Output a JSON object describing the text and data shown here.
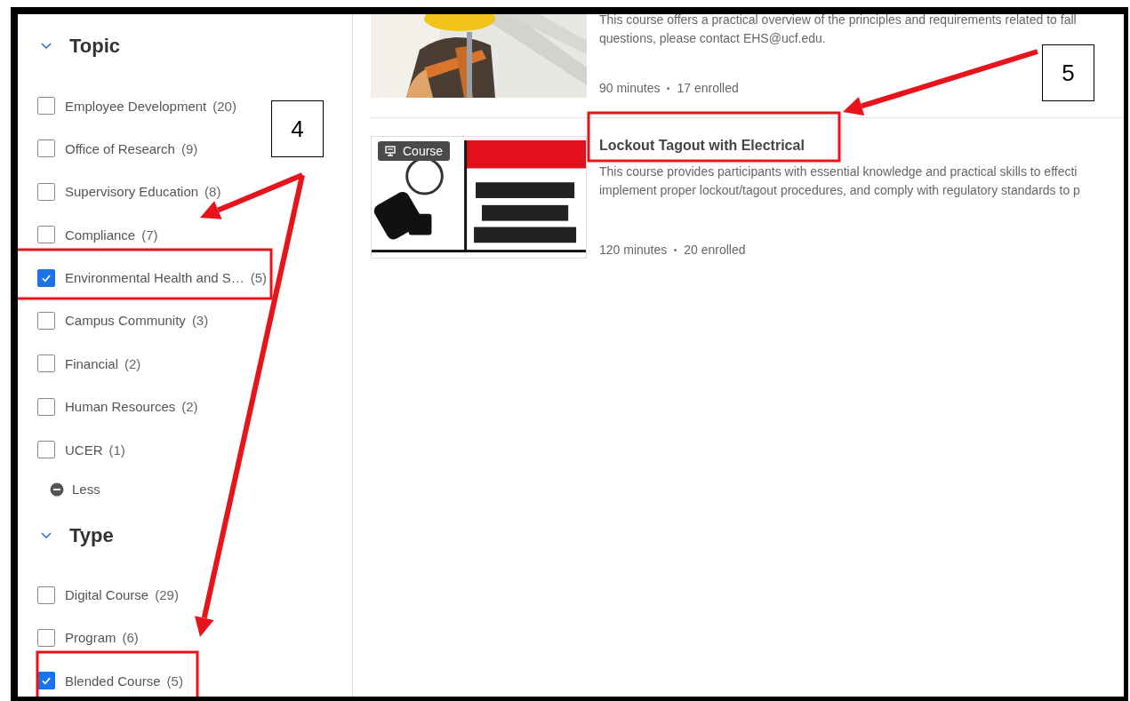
{
  "filters": [
    {
      "title": "Topic",
      "expanded": true,
      "options": [
        {
          "label": "Employee Development",
          "count": "(20)",
          "checked": false
        },
        {
          "label": "Office of Research",
          "count": "(9)",
          "checked": false
        },
        {
          "label": "Supervisory Education",
          "count": "(8)",
          "checked": false
        },
        {
          "label": "Compliance",
          "count": "(7)",
          "checked": false
        },
        {
          "label": "Environmental Health and S…",
          "count": "(5)",
          "checked": true
        },
        {
          "label": "Campus Community",
          "count": "(3)",
          "checked": false
        },
        {
          "label": "Financial",
          "count": "(2)",
          "checked": false
        },
        {
          "label": "Human Resources",
          "count": "(2)",
          "checked": false
        },
        {
          "label": "UCER",
          "count": "(1)",
          "checked": false
        }
      ],
      "less_link": "Less"
    },
    {
      "title": "Type",
      "expanded": true,
      "options": [
        {
          "label": "Digital Course",
          "count": "(29)",
          "checked": false
        },
        {
          "label": "Program",
          "count": "(6)",
          "checked": false
        },
        {
          "label": "Blended Course",
          "count": "(5)",
          "checked": true
        }
      ]
    }
  ],
  "results": [
    {
      "description": [
        "This course offers a practical overview of the principles and requirements related to fall",
        "questions, please contact EHS@ucf.edu."
      ],
      "duration": "90 minutes",
      "enrolled": "17 enrolled"
    },
    {
      "badge": "Course",
      "title": "Lockout Tagout with Electrical",
      "description": [
        "This course provides participants with essential knowledge and practical skills to effecti",
        "implement proper lockout/tagout procedures, and comply with regulatory standards to p"
      ],
      "duration": "120 minutes",
      "enrolled": "20 enrolled",
      "kind": "sign"
    }
  ],
  "annotations": [
    {
      "label": "4"
    },
    {
      "label": "5"
    }
  ]
}
